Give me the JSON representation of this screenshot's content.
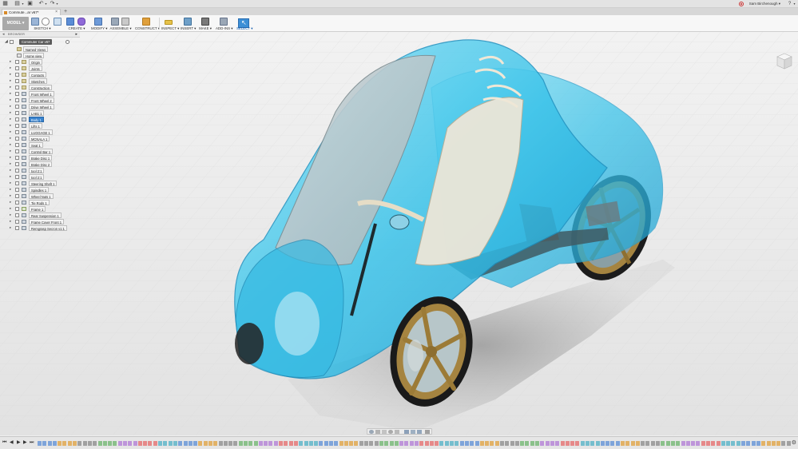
{
  "title_bar": {
    "user_name": "Sam Birchenough",
    "user_caret": "▾",
    "help_icon": "?",
    "help_caret": "▾"
  },
  "document_tab": {
    "label": "Commute...ar v67*",
    "close": "×",
    "new_tab": "+"
  },
  "toolbar": {
    "workspace_label": "MODEL ▾",
    "groups": [
      {
        "label": "SKETCH ▾"
      },
      {
        "label": "CREATE ▾"
      },
      {
        "label": "MODIFY ▾"
      },
      {
        "label": "ASSEMBLE ▾"
      },
      {
        "label": "CONSTRUCT ▾"
      },
      {
        "label": "INSPECT ▾"
      },
      {
        "label": "INSERT ▾"
      },
      {
        "label": "MAKE ▾"
      },
      {
        "label": "ADD-INS ▾"
      },
      {
        "label": "SELECT ▾"
      }
    ]
  },
  "browser": {
    "header_label": "BROWSER",
    "root_label": "Commuter Car v67",
    "items": [
      {
        "label": "Named Views",
        "kind": "folder",
        "top": true
      },
      {
        "label": "Home view",
        "kind": "view",
        "top": true
      },
      {
        "label": "Origin",
        "kind": "folder"
      },
      {
        "label": "Joints",
        "kind": "folder"
      },
      {
        "label": "Contacts",
        "kind": "folder"
      },
      {
        "label": "Sketches",
        "kind": "folder"
      },
      {
        "label": "Construction",
        "kind": "folder"
      },
      {
        "label": "Front Wheel 1",
        "kind": "comp"
      },
      {
        "label": "Front Wheel 2",
        "kind": "comp"
      },
      {
        "label": "Drive Wheel 1",
        "kind": "comp"
      },
      {
        "label": "LAB1 1",
        "kind": "comp"
      },
      {
        "label": "Body 1",
        "kind": "comp",
        "selected": true
      },
      {
        "label": "Lifts 1",
        "kind": "comp"
      },
      {
        "label": "LUGGAGE 1",
        "kind": "comp"
      },
      {
        "label": "MCNALA 1",
        "kind": "comp"
      },
      {
        "label": "Seat 1",
        "kind": "comp"
      },
      {
        "label": "Control Bar 1",
        "kind": "comp"
      },
      {
        "label": "Brake Disc 1",
        "kind": "comp"
      },
      {
        "label": "Brake Disc 2",
        "kind": "comp"
      },
      {
        "label": "tool 2:1",
        "kind": "comp"
      },
      {
        "label": "tool 2:1",
        "kind": "comp"
      },
      {
        "label": "Steering Shaft 1",
        "kind": "comp"
      },
      {
        "label": "Spindles 1",
        "kind": "comp"
      },
      {
        "label": "Wheel Nuts 1",
        "kind": "comp"
      },
      {
        "label": "Tie Rods 1",
        "kind": "comp"
      },
      {
        "label": "Frame 1",
        "kind": "link"
      },
      {
        "label": "Rear Suspension 1",
        "kind": "comp"
      },
      {
        "label": "Frame Cover Front 1",
        "kind": "comp"
      },
      {
        "label": "Remgrasp Secron v1:1",
        "kind": "comp"
      }
    ]
  },
  "timeline": {
    "marker_count": 150,
    "colors": [
      "#5b8dd6",
      "#e0a03c",
      "#8a8a8a",
      "#6cb46c",
      "#b07ad6",
      "#e56a6a",
      "#4fb0c6"
    ]
  },
  "colors": {
    "body_cyan": "#39c0e6",
    "wheel_bronze": "#a58440",
    "selection_blue": "#3a84cf"
  }
}
